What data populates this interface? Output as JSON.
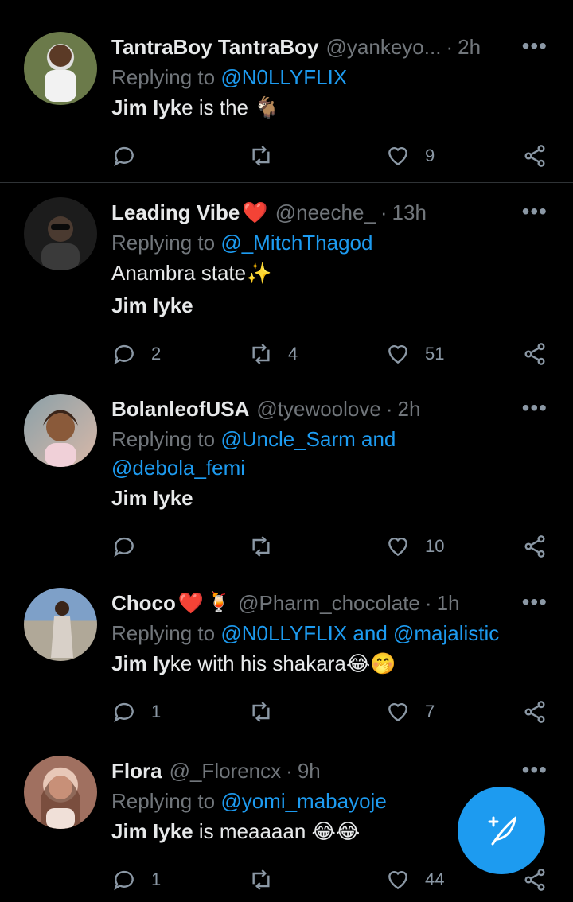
{
  "tweets": [
    {
      "name": "TantraBoy TantraBoy",
      "handle": "@yankeyo...",
      "time": "2h",
      "replying_prefix": "Replying to ",
      "replying_to": "@N0LLYFLIX",
      "lines": [
        [
          "Jim Iyk",
          "e is the 🐐"
        ]
      ],
      "reply_count": "",
      "retweet_count": "",
      "like_count": "9",
      "avatar_color": "#3a5a2a"
    },
    {
      "name": "Leading Vibe",
      "name_heart": "❤️",
      "handle": "@neeche_",
      "time": "13h",
      "replying_prefix": "Replying to ",
      "replying_to": "@_MitchThagod",
      "lines": [
        "Anambra state✨",
        "Jim Iyke"
      ],
      "reply_count": "2",
      "retweet_count": "4",
      "like_count": "51",
      "avatar_color": "#2a2a2a"
    },
    {
      "name": "BolanleofUSA",
      "handle": "@tyewoolove",
      "time": "2h",
      "replying_prefix": "Replying to ",
      "replying_to": "@Uncle_Sarm and",
      "replying_to_2": "@debola_femi",
      "lines": [
        "Jim Iyke"
      ],
      "reply_count": "",
      "retweet_count": "",
      "like_count": "10",
      "avatar_color": "#c9a08a"
    },
    {
      "name": "Choco",
      "name_heart": "❤️",
      "name_emoji": "🍹",
      "handle": "@Pharm_chocolate",
      "time": "1h",
      "replying_prefix": "Replying to ",
      "replying_to": "@N0LLYFLIX and @majalistic",
      "lines": [
        [
          "Jim Iy",
          "ke with his shakara😂🤭"
        ]
      ],
      "reply_count": "1",
      "retweet_count": "",
      "like_count": "7",
      "avatar_color": "#6d8aa8"
    },
    {
      "name": "Flora",
      "handle": "@_Florencx",
      "time": "9h",
      "replying_prefix": "Replying to ",
      "replying_to": "@yomi_mabayoje",
      "lines": [
        [
          "Jim Iyke",
          " is meaaaan 😂😂"
        ]
      ],
      "reply_count": "1",
      "retweet_count": "",
      "like_count": "44",
      "avatar_color": "#b89070"
    }
  ],
  "more_label": "•••",
  "dot_sep": "·",
  "colors": {
    "accent": "#1d9bf0",
    "heart": "#f91880",
    "muted": "#71767b",
    "divider": "#2f3336"
  }
}
